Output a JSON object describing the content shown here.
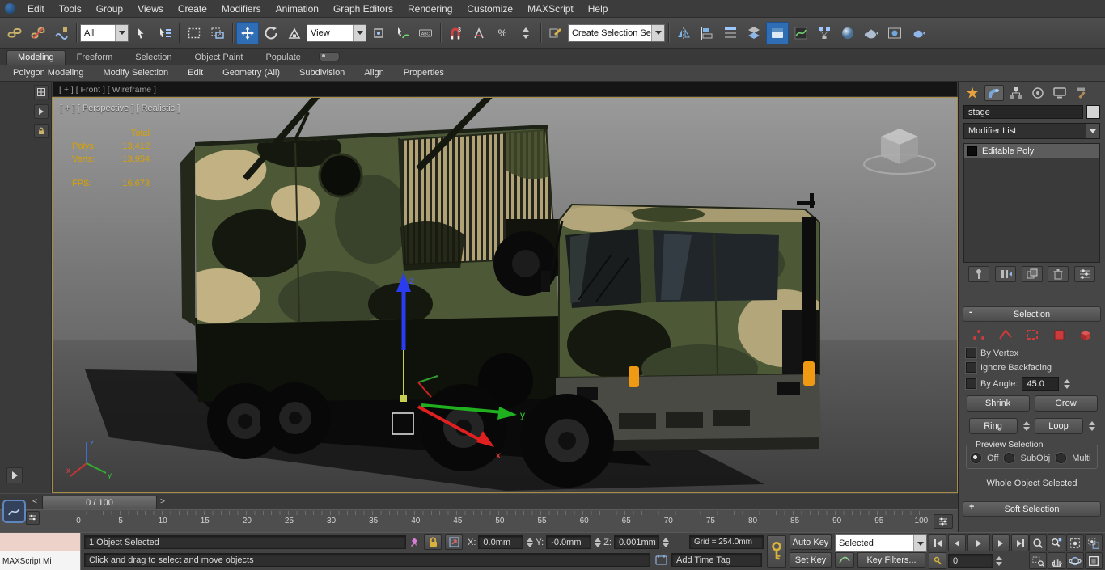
{
  "menubar": {
    "items": [
      "Edit",
      "Tools",
      "Group",
      "Views",
      "Create",
      "Modifiers",
      "Animation",
      "Graph Editors",
      "Rendering",
      "Customize",
      "MAXScript",
      "Help"
    ]
  },
  "toolbar": {
    "selection_filter": "All",
    "ref_coord": "View",
    "selection_set": "Create Selection Se",
    "snap_3d_glyph": "3",
    "percent_glyph": "%",
    "abc_glyph": "ABC"
  },
  "ribbon": {
    "tabs": [
      "Modeling",
      "Freeform",
      "Selection",
      "Object Paint",
      "Populate"
    ],
    "subtabs": [
      "Polygon Modeling",
      "Modify Selection",
      "Edit",
      "Geometry (All)",
      "Subdivision",
      "Align",
      "Properties"
    ]
  },
  "viewport": {
    "front_label": "[ + ] [ Front ] [ Wireframe ]",
    "label": "[ + ] [ Perspective ] [ Realistic ]",
    "stats": {
      "total_label": "Total",
      "polys_label": "Polys:",
      "polys_value": "13,412",
      "verts_label": "Verts:",
      "verts_value": "13,954",
      "fps_label": "FPS:",
      "fps_value": "16.673"
    },
    "axis": {
      "x": "x",
      "y": "y",
      "z": "z"
    }
  },
  "timeline": {
    "slider_label": "0 / 100",
    "prev_glyph": "<",
    "next_glyph": ">",
    "ticks": [
      "0",
      "5",
      "10",
      "15",
      "20",
      "25",
      "30",
      "35",
      "40",
      "45",
      "50",
      "55",
      "60",
      "65",
      "70",
      "75",
      "80",
      "85",
      "90",
      "95",
      "100"
    ]
  },
  "command_panel": {
    "object_name": "stage",
    "modifier_list": "Modifier List",
    "stack_item": "Editable Poly",
    "selection": {
      "title": "Selection",
      "collapse": "-",
      "by_vertex": "By Vertex",
      "ignore_backfacing": "Ignore Backfacing",
      "by_angle": "By Angle:",
      "angle_value": "45.0",
      "shrink": "Shrink",
      "grow": "Grow",
      "ring": "Ring",
      "loop": "Loop",
      "preview_title": "Preview Selection",
      "preview_off": "Off",
      "preview_subobj": "SubObj",
      "preview_multi": "Multi",
      "status": "Whole Object Selected"
    },
    "soft_selection": {
      "title": "Soft Selection",
      "expand": "+"
    }
  },
  "statusbar": {
    "maxscript_label": "MAXScript Mi",
    "selection_status": "1 Object Selected",
    "prompt": "Click and drag to select and move objects",
    "x_label": "X:",
    "x_value": "0.0mm",
    "y_label": "Y:",
    "y_value": "-0.0mm",
    "z_label": "Z:",
    "z_value": "0.001mm",
    "grid_value": "Grid = 254.0mm",
    "add_time_tag": "Add Time Tag",
    "auto_key": "Auto Key",
    "set_key": "Set Key",
    "key_filter_mode": "Selected",
    "key_filters": "Key Filters...",
    "frame_value": "0"
  }
}
